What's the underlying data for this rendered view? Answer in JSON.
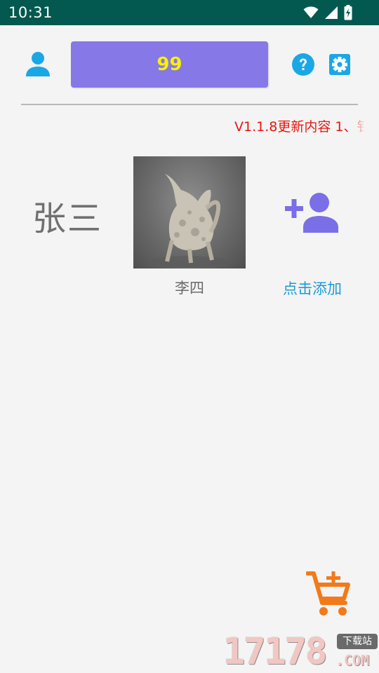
{
  "status_bar": {
    "time": "10:31",
    "icons": [
      "wifi-icon",
      "signal-icon",
      "battery-icon"
    ]
  },
  "header": {
    "count": "99",
    "count_bg": "#8678e6",
    "count_color": "#f8f100",
    "accent": "#1aa7e6"
  },
  "announcement": {
    "text": "V1.1.8更新内容 1、钅"
  },
  "people": {
    "first_name": "张三",
    "second_name": "李四",
    "add_label": "点击添加"
  },
  "icons": {
    "user": "user-icon",
    "help": "help-icon",
    "settings": "gear-icon",
    "add_user": "add-user-icon",
    "cart": "add-to-cart-icon"
  },
  "watermark": {
    "digits": "17178",
    "tag": "下载站",
    "suffix": ".COM"
  }
}
